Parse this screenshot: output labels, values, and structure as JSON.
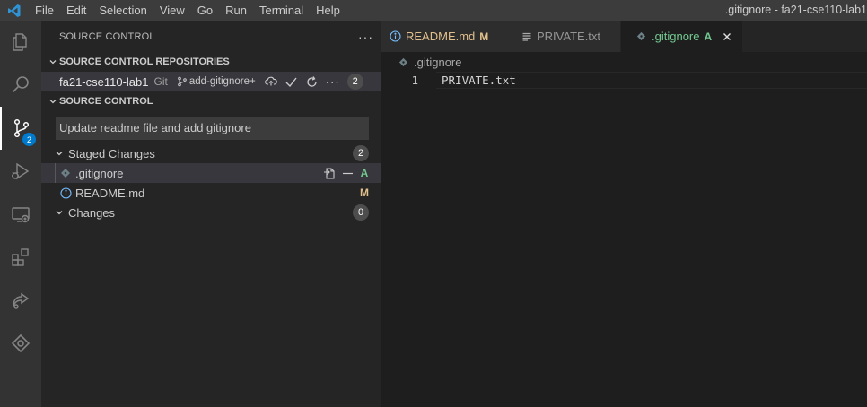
{
  "titlebar": {
    "menu": [
      "File",
      "Edit",
      "Selection",
      "View",
      "Go",
      "Run",
      "Terminal",
      "Help"
    ],
    "window_title": ".gitignore - fa21-cse110-lab1"
  },
  "activitybar": {
    "items": [
      "explorer-icon",
      "search-icon",
      "source-control-icon",
      "run-debug-icon",
      "remote-explorer-icon",
      "extensions-icon",
      "live-share-icon",
      "gitlens-icon"
    ],
    "source_control_badge": "2"
  },
  "sidebar": {
    "title": "SOURCE CONTROL",
    "more_label": "···",
    "repositories": {
      "header": "SOURCE CONTROL REPOSITORIES",
      "repo": {
        "name": "fa21-cse110-lab1",
        "type": "Git",
        "branch": "add-gitignore+",
        "count": "2"
      }
    },
    "source_control": {
      "header": "SOURCE CONTROL",
      "commit_message": "Update readme file and add gitignore",
      "staged": {
        "label": "Staged Changes",
        "count": "2",
        "files": [
          {
            "name": ".gitignore",
            "status": "A"
          },
          {
            "name": "README.md",
            "status": "M"
          }
        ]
      },
      "changes": {
        "label": "Changes",
        "count": "0"
      }
    }
  },
  "editor": {
    "tabs": [
      {
        "label": "README.md",
        "deco": "M"
      },
      {
        "label": "PRIVATE.txt",
        "deco": ""
      },
      {
        "label": ".gitignore",
        "deco": "A"
      }
    ],
    "breadcrumb": ".gitignore",
    "lines": [
      {
        "number": "1",
        "text": "PRIVATE.txt"
      }
    ]
  },
  "colors": {
    "accent": "#007acc",
    "added": "#73c991",
    "modified": "#e2c08d"
  }
}
